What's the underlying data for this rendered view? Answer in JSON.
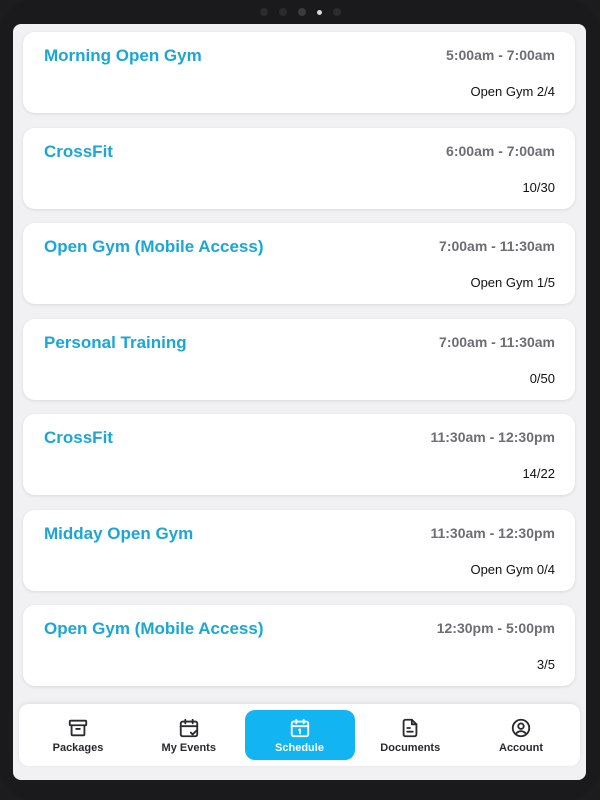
{
  "schedule": {
    "events": [
      {
        "title": "Morning Open Gym",
        "time": "5:00am - 7:00am",
        "capacity": "Open Gym 2/4"
      },
      {
        "title": "CrossFit",
        "time": "6:00am - 7:00am",
        "capacity": "10/30"
      },
      {
        "title": "Open Gym (Mobile Access)",
        "time": "7:00am - 11:30am",
        "capacity": "Open Gym 1/5"
      },
      {
        "title": "Personal Training",
        "time": "7:00am - 11:30am",
        "capacity": "0/50"
      },
      {
        "title": "CrossFit",
        "time": "11:30am - 12:30pm",
        "capacity": "14/22"
      },
      {
        "title": "Midday Open Gym",
        "time": "11:30am - 12:30pm",
        "capacity": "Open Gym 0/4"
      },
      {
        "title": "Open Gym (Mobile Access)",
        "time": "12:30pm - 5:00pm",
        "capacity": "3/5"
      }
    ]
  },
  "tabbar": {
    "active_tab": "Schedule",
    "tabs": [
      {
        "label": "Packages",
        "icon": "archive-box-icon"
      },
      {
        "label": "My Events",
        "icon": "calendar-check-icon"
      },
      {
        "label": "Schedule",
        "icon": "calendar-icon"
      },
      {
        "label": "Documents",
        "icon": "document-icon"
      },
      {
        "label": "Account",
        "icon": "user-circle-icon"
      }
    ]
  },
  "colors": {
    "accent": "#12b5f1",
    "title_text": "#1aa7d6",
    "time_text": "#6d6d72",
    "background": "#f1f1f3"
  }
}
